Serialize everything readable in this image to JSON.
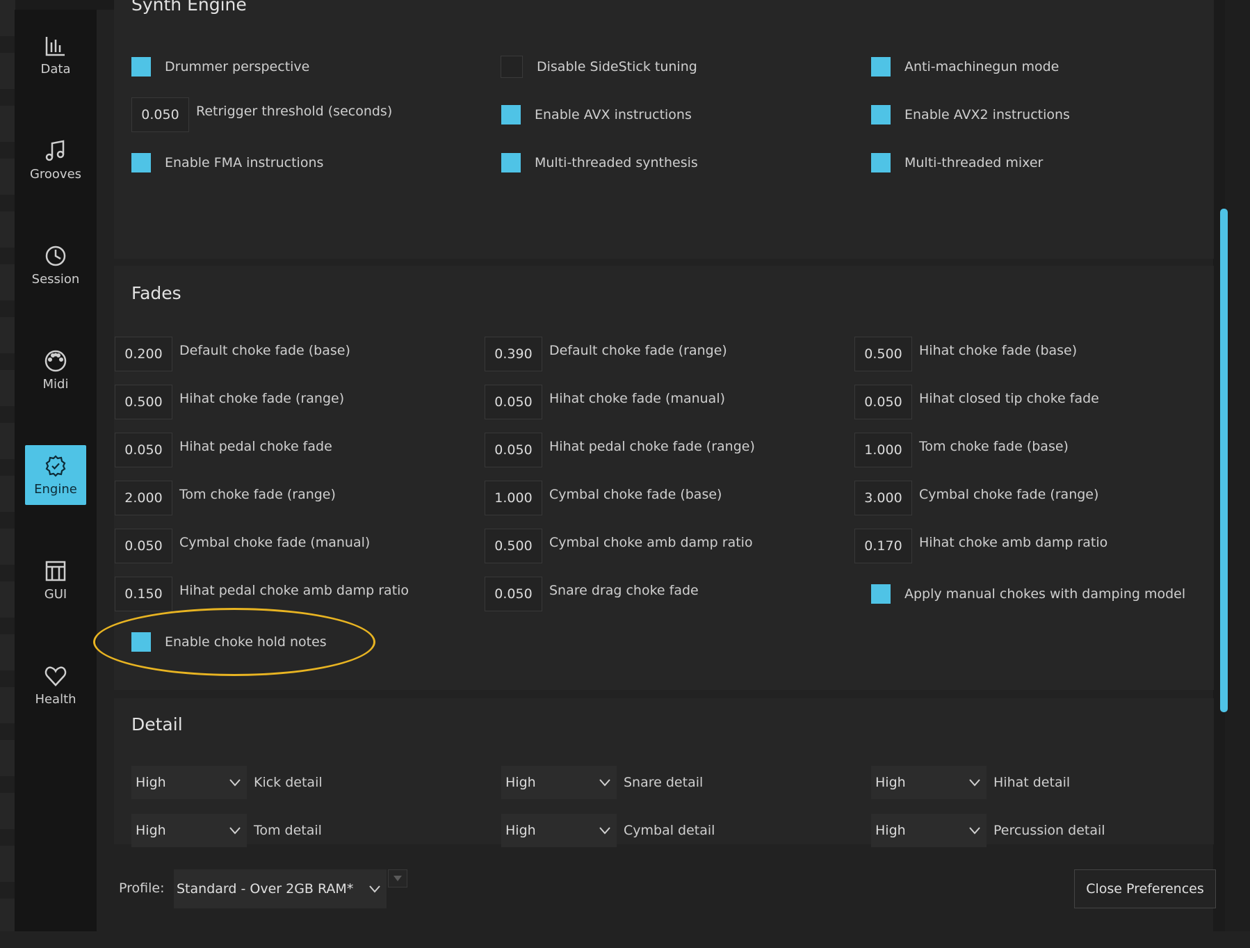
{
  "sidebar": {
    "items": [
      {
        "label": "Data",
        "icon": "bar-chart-icon",
        "active": false
      },
      {
        "label": "Grooves",
        "icon": "music-note-icon",
        "active": false
      },
      {
        "label": "Session",
        "icon": "clock-icon",
        "active": false
      },
      {
        "label": "Midi",
        "icon": "midi-port-icon",
        "active": false
      },
      {
        "label": "Engine",
        "icon": "gear-badge-icon",
        "active": true
      },
      {
        "label": "GUI",
        "icon": "layout-icon",
        "active": false
      },
      {
        "label": "Health",
        "icon": "heart-icon",
        "active": false
      }
    ]
  },
  "synth": {
    "title": "Synth Engine",
    "drummer_perspective": "Drummer perspective",
    "disable_sidestick": "Disable SideStick tuning",
    "anti_machinegun": "Anti-machinegun mode",
    "retrigger_value": "0.050",
    "retrigger_label": "Retrigger threshold (seconds)",
    "avx": "Enable AVX instructions",
    "avx2": "Enable AVX2 instructions",
    "fma": "Enable FMA instructions",
    "mt_synthesis": "Multi-threaded synthesis",
    "mt_mixer": "Multi-threaded mixer"
  },
  "fades": {
    "title": "Fades",
    "fields": [
      {
        "value": "0.200",
        "label": "Default choke fade (base)"
      },
      {
        "value": "0.390",
        "label": "Default choke fade (range)"
      },
      {
        "value": "0.500",
        "label": "Hihat choke fade (base)"
      },
      {
        "value": "0.500",
        "label": "Hihat choke fade (range)"
      },
      {
        "value": "0.050",
        "label": "Hihat choke fade (manual)"
      },
      {
        "value": "0.050",
        "label": "Hihat closed tip choke fade"
      },
      {
        "value": "0.050",
        "label": "Hihat pedal choke fade"
      },
      {
        "value": "0.050",
        "label": "Hihat pedal choke fade (range)"
      },
      {
        "value": "1.000",
        "label": "Tom choke fade (base)"
      },
      {
        "value": "2.000",
        "label": "Tom choke fade (range)"
      },
      {
        "value": "1.000",
        "label": "Cymbal choke fade (base)"
      },
      {
        "value": "3.000",
        "label": "Cymbal choke fade (range)"
      },
      {
        "value": "0.050",
        "label": "Cymbal choke fade (manual)"
      },
      {
        "value": "0.500",
        "label": "Cymbal choke amb damp ratio"
      },
      {
        "value": "0.170",
        "label": "Hihat choke amb damp ratio"
      },
      {
        "value": "0.150",
        "label": "Hihat pedal choke amb damp ratio"
      },
      {
        "value": "0.050",
        "label": "Snare drag choke fade"
      }
    ],
    "apply_manual_chokes": "Apply manual chokes with damping model",
    "enable_choke_hold": "Enable choke hold notes"
  },
  "detail": {
    "title": "Detail",
    "rows": [
      {
        "value": "High",
        "label": "Kick detail"
      },
      {
        "value": "High",
        "label": "Snare detail"
      },
      {
        "value": "High",
        "label": "Hihat detail"
      },
      {
        "value": "High",
        "label": "Tom detail"
      },
      {
        "value": "High",
        "label": "Cymbal detail"
      },
      {
        "value": "High",
        "label": "Percussion detail"
      }
    ]
  },
  "footer": {
    "profile_label": "Profile:",
    "profile_value": "Standard - Over 2GB RAM*",
    "close_label": "Close Preferences"
  },
  "colors": {
    "accent": "#4fc3e6",
    "highlight": "#e8b422"
  }
}
